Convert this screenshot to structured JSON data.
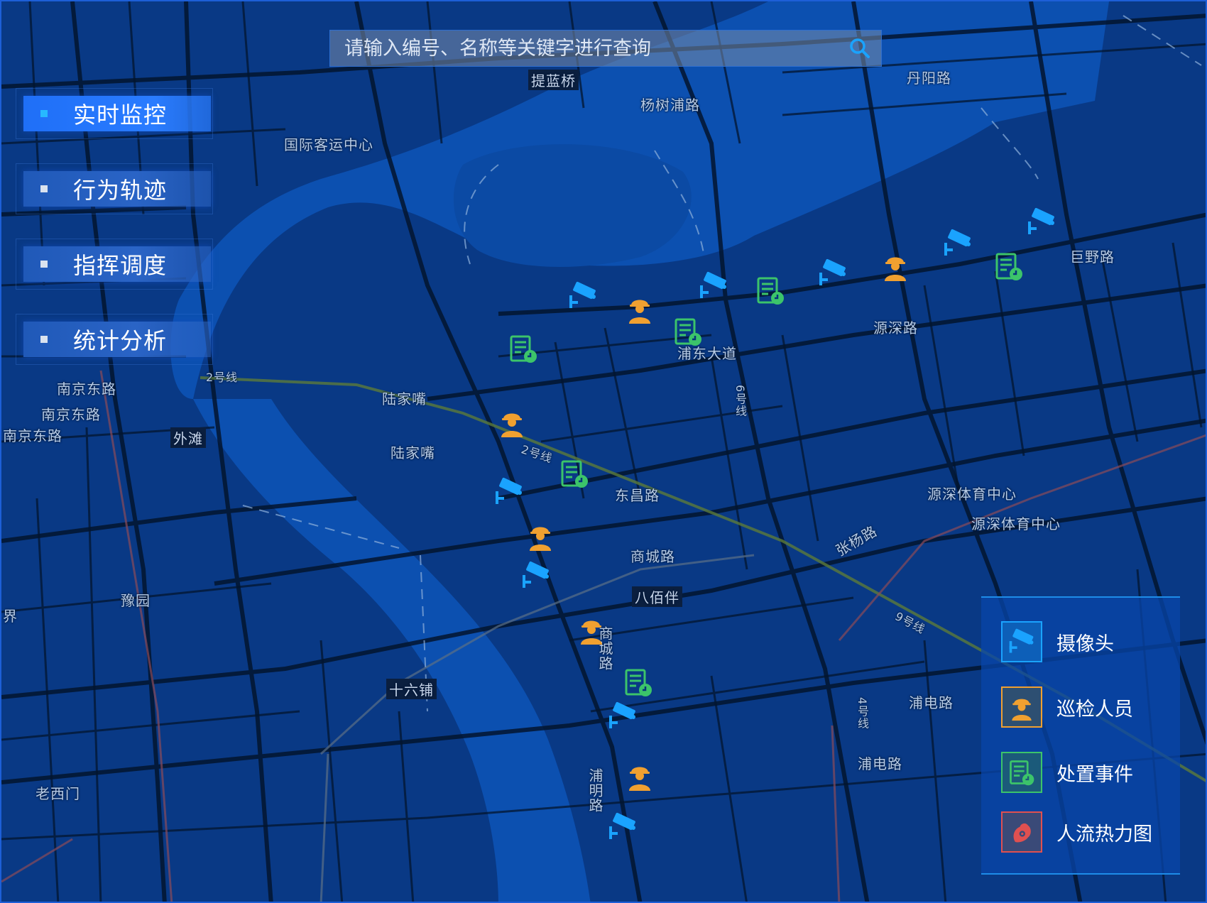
{
  "search": {
    "placeholder": "请输入编号、名称等关键字进行查询",
    "icon": "search-icon"
  },
  "nav": {
    "items": [
      {
        "label": "实时监控",
        "active": true
      },
      {
        "label": "行为轨迹",
        "active": false
      },
      {
        "label": "指挥调度",
        "active": false
      },
      {
        "label": "统计分析",
        "active": false
      }
    ]
  },
  "map": {
    "labels": [
      "提蓝桥",
      "杨树浦路",
      "丹阳路",
      "国际客运中心",
      "巨野路",
      "源深路",
      "浦东大道",
      "南京东路",
      "南京东路",
      "南京东路",
      "2号线",
      "陆家嘴",
      "陆家嘴",
      "外滩",
      "2号线",
      "东昌路",
      "源深体育中心",
      "源深体育中心",
      "张杨路",
      "商城路",
      "八佰伴",
      "豫园",
      "9号线",
      "十六铺",
      "浦电路",
      "浦电路",
      "浦明路",
      "老西门",
      "6号线",
      "4号线",
      "商城路",
      "界"
    ]
  },
  "legend": {
    "items": [
      {
        "label": "摄像头",
        "icon": "camera-icon",
        "color": "#1aa3ff"
      },
      {
        "label": "巡检人员",
        "icon": "worker-icon",
        "color": "#f0a030"
      },
      {
        "label": "处置事件",
        "icon": "event-icon",
        "color": "#3cc46a"
      },
      {
        "label": "人流热力图",
        "icon": "heatmap-icon",
        "color": "#e05050"
      }
    ]
  },
  "colors": {
    "camera": "#1aa3ff",
    "worker": "#f0a030",
    "event": "#3cc46a",
    "heat": "#e05050",
    "accent": "#1f6ff7"
  }
}
